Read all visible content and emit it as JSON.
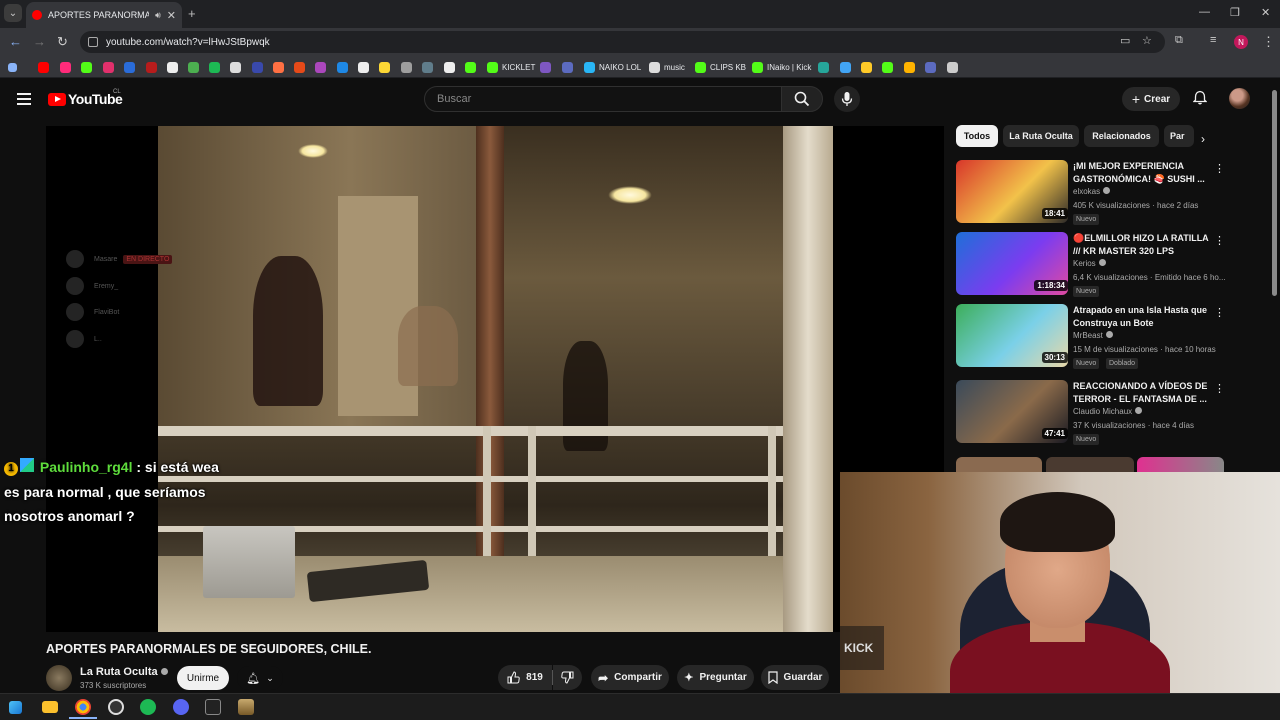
{
  "browser": {
    "tab_title": "APORTES PARANORMALES",
    "url": "youtube.com/watch?v=lHwJStBpwqk",
    "bookmarks": [
      "KICKLET",
      "NAIKO LOL",
      "music",
      "CLIPS KB",
      "INaiko | Kick"
    ],
    "icons": [
      "tab-list-icon",
      "speaker-icon",
      "close-tab-icon",
      "new-tab-icon",
      "minimize-icon",
      "restore-icon",
      "window-close-icon",
      "back-icon",
      "forward-icon",
      "reload-icon",
      "site-settings-icon",
      "cast-icon",
      "star-icon",
      "extensions-icon",
      "profile-icon",
      "menu-icon"
    ],
    "profile_letter": "N"
  },
  "header": {
    "logo_text": "YouTube",
    "country": "CL",
    "search_placeholder": "Buscar",
    "create_label": "Crear"
  },
  "chat_overlay": {
    "ghost_rows": [
      {
        "name": "Masare",
        "badge": "EN DIRECTO"
      },
      {
        "name": "Eremy_"
      },
      {
        "name": "FlaviBot"
      },
      {
        "name": "L.."
      }
    ],
    "message": {
      "rank": "1",
      "user": "Paulinho_rg4l",
      "text": ": si está wea es para normal , que seríamos nosotros anomarl ?"
    }
  },
  "video": {
    "title": "APORTES PARANORMALES DE SEGUIDORES, CHILE.",
    "channel_name": "La Ruta Oculta",
    "subscribers": "373 K suscriptores",
    "join_label": "Unirme",
    "likes": "819",
    "share_label": "Compartir",
    "ask_label": "Preguntar",
    "save_label": "Guardar"
  },
  "chips": [
    "Todos",
    "La Ruta Oculta",
    "Relacionados",
    "Par"
  ],
  "recommendations": [
    {
      "title": "¡MI MEJOR EXPERIENCIA GASTRONÓMICA! 🍣 SUSHI ...",
      "channel": "elxokas",
      "meta": "405 K visualizaciones · hace 2 días",
      "badge": "Nuevo",
      "duration": "18:41",
      "colors": [
        "#d8362a",
        "#f2c24a",
        "#2d2a28"
      ]
    },
    {
      "title": "🔴ELMILLOR HIZO LA RATILLA /// KR MASTER 320 LPS",
      "channel": "Kerios",
      "meta": "6,4 K visualizaciones · Emitido hace 6 ho...",
      "badge": "Nuevo",
      "duration": "1:18:34",
      "colors": [
        "#1e6fd8",
        "#7b3cf0",
        "#e04aa0"
      ]
    },
    {
      "title": "Atrapado en una Isla Hasta que Construya un Bote",
      "channel": "MrBeast",
      "meta": "15 M de visualizaciones · hace 10 horas",
      "badge": "Nuevo",
      "badge2": "Doblado",
      "duration": "30:13",
      "colors": [
        "#3cae5a",
        "#7ad0e8",
        "#e8d8a8"
      ]
    },
    {
      "title": "REACCIONANDO A VÍDEOS DE TERROR - EL FANTASMA DE ...",
      "channel": "Claudio Michaux",
      "meta": "37 K visualizaciones · hace 4 días",
      "badge": "Nuevo",
      "duration": "47:41",
      "colors": [
        "#3a4a5a",
        "#8a6a4a",
        "#1a1a22"
      ]
    }
  ],
  "webcam": {
    "logo_text": "KICK"
  },
  "taskbar": {
    "apps": [
      "windows-start-icon",
      "file-explorer-icon",
      "chrome-icon",
      "obs-icon",
      "spotify-icon",
      "discord-icon",
      "vrchat-icon",
      "league-icon"
    ]
  }
}
